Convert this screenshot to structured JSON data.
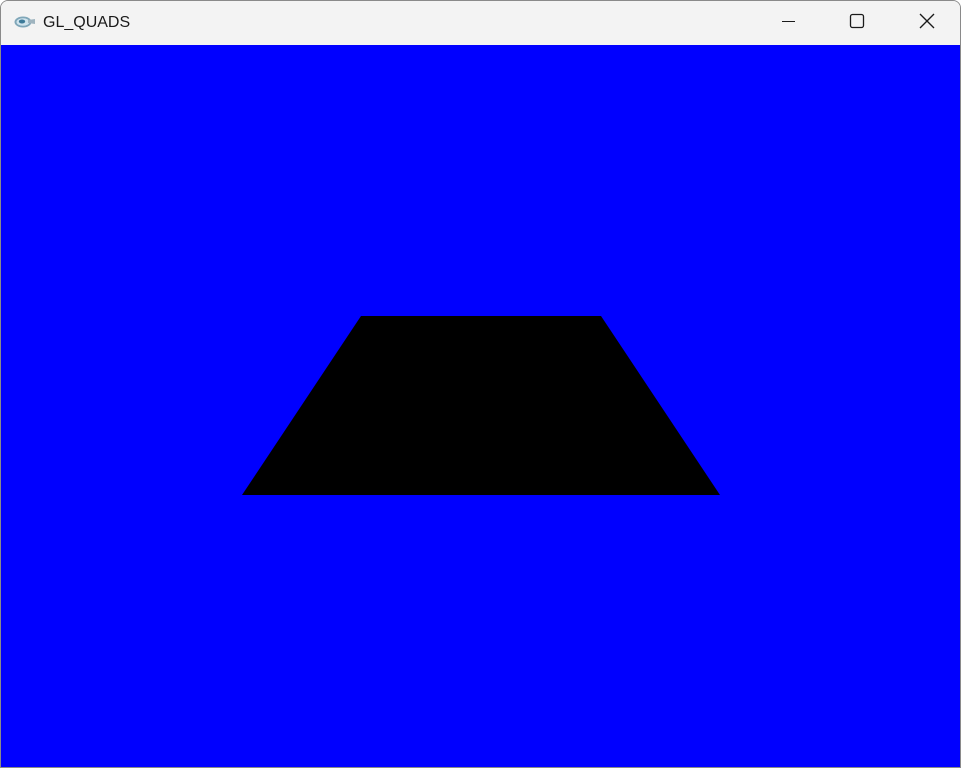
{
  "window": {
    "title": "GL_QUADS",
    "controls": {
      "minimize_icon": "minimize-icon",
      "maximize_icon": "maximize-icon",
      "close_icon": "close-icon"
    }
  },
  "canvas": {
    "background_color": "#0000ff",
    "shape": {
      "type": "quad",
      "fill_color": "#000000"
    }
  }
}
